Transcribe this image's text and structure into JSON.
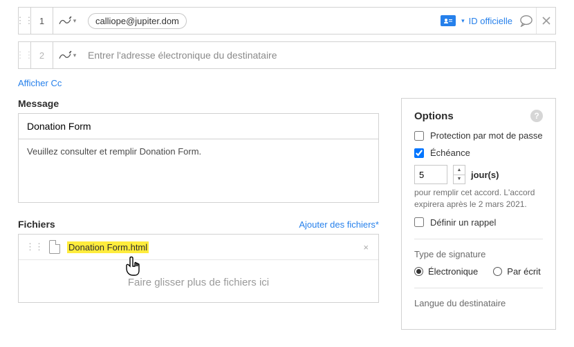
{
  "recipients": [
    {
      "num": "1",
      "email": "calliope@jupiter.dom",
      "id_label": "ID officielle"
    },
    {
      "num": "2",
      "placeholder": "Entrer l'adresse électronique du destinataire"
    }
  ],
  "show_cc": "Afficher Cc",
  "message": {
    "label": "Message",
    "subject": "Donation Form",
    "body": "Veuillez consulter et remplir Donation Form."
  },
  "files": {
    "label": "Fichiers",
    "add": "Ajouter des fichiers*",
    "items": [
      {
        "name": "Donation Form.html"
      }
    ],
    "dropzone": "Faire glisser plus de fichiers ici"
  },
  "options": {
    "title": "Options",
    "pwd": "Protection par mot de passe",
    "deadline": "Échéance",
    "days_value": "5",
    "days_unit": "jour(s)",
    "hint": "pour remplir cet accord. L'accord expirera après le 2 mars 2021.",
    "reminder": "Définir un rappel",
    "sig_type": "Type de signature",
    "sig_elec": "Électronique",
    "sig_written": "Par écrit",
    "lang": "Langue du destinataire"
  }
}
